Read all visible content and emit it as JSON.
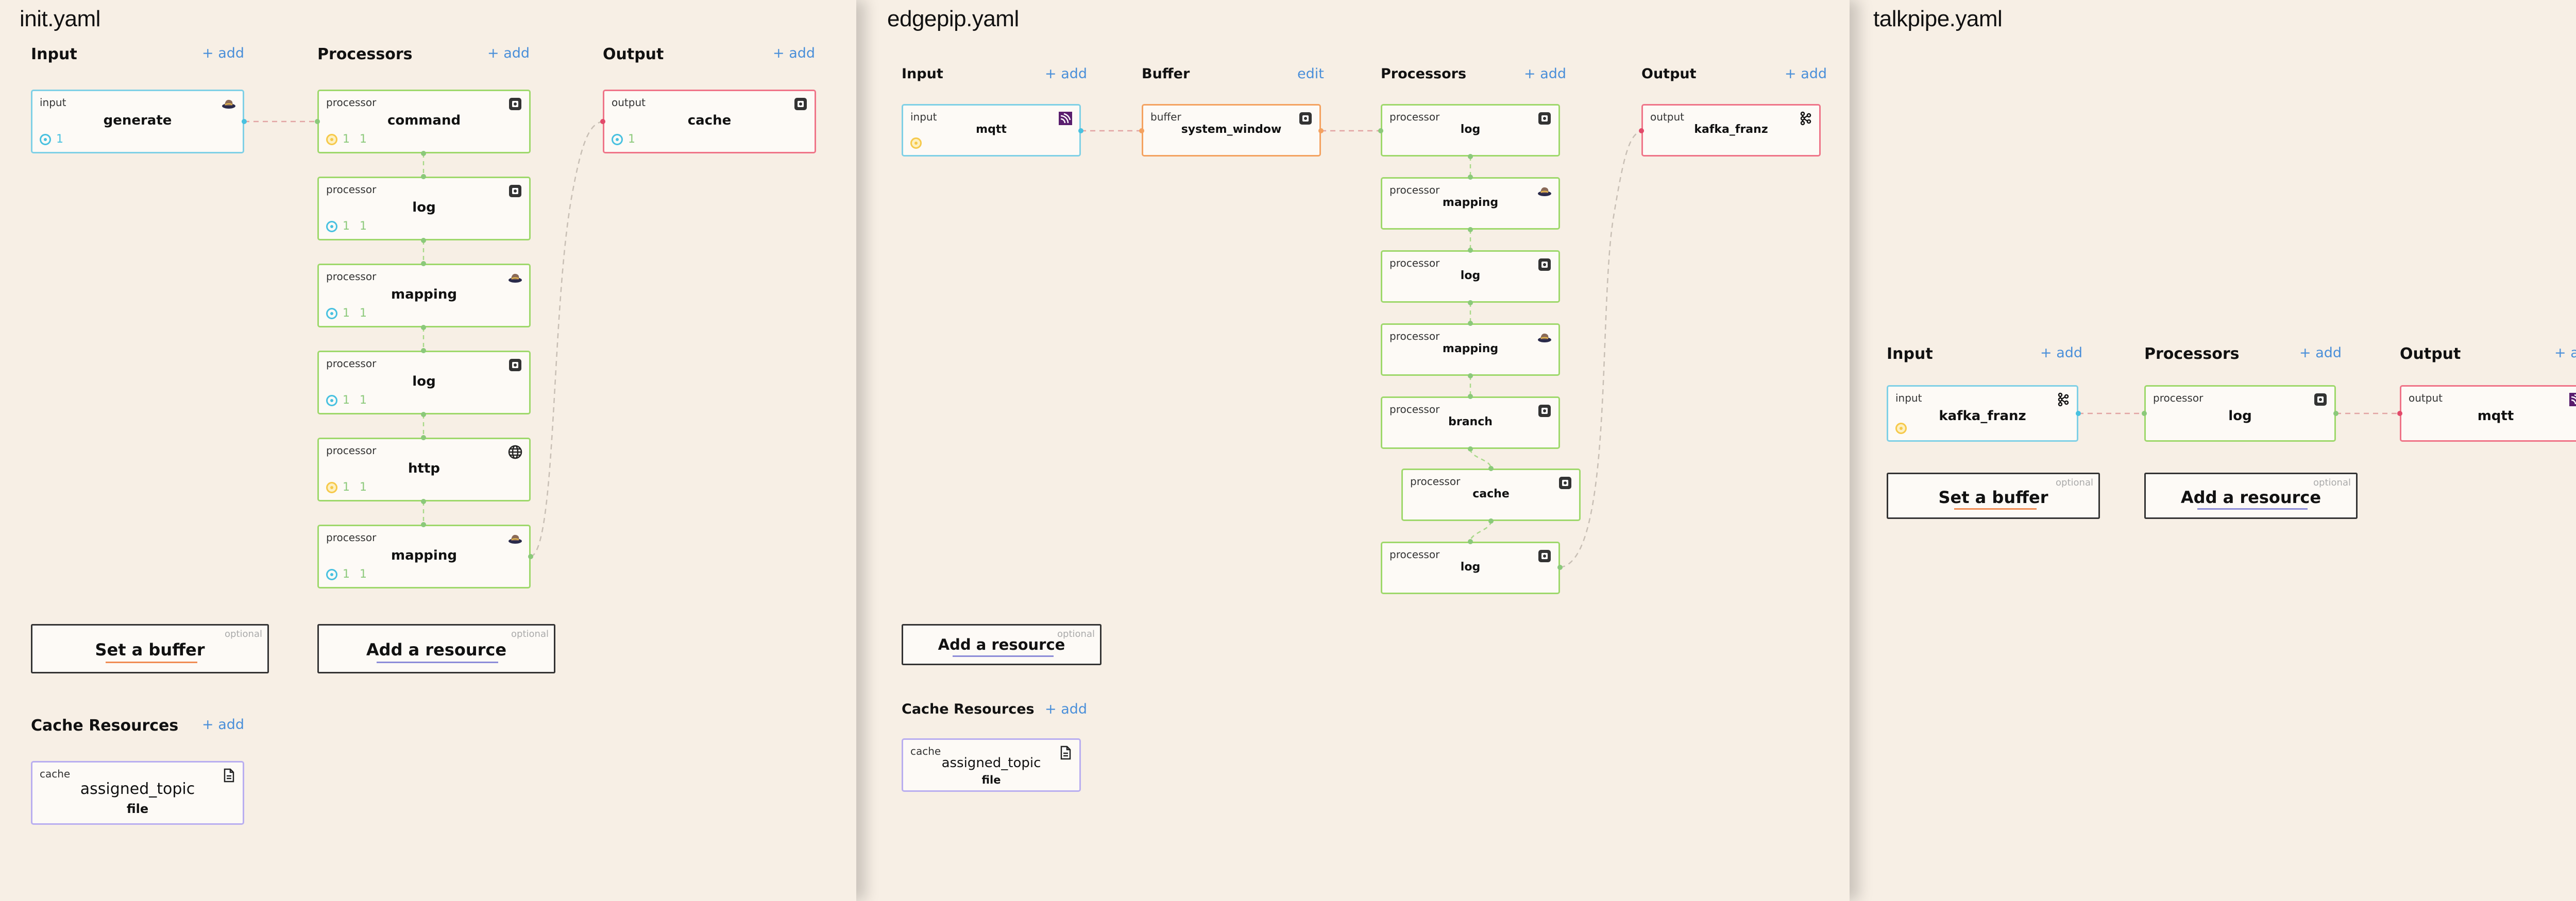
{
  "panels": {
    "init": {
      "title": "init.yaml",
      "input": {
        "heading": "Input",
        "add": "+ add",
        "kind": "input",
        "name": "generate",
        "icon": "bloblang-hat-icon",
        "stat": "1"
      },
      "processors": {
        "heading": "Processors",
        "add": "+ add",
        "items": [
          {
            "kind": "processor",
            "name": "command",
            "icon": "box-icon",
            "stat": "1 1"
          },
          {
            "kind": "processor",
            "name": "log",
            "icon": "box-icon",
            "stat": "1 1"
          },
          {
            "kind": "processor",
            "name": "mapping",
            "icon": "bloblang-hat-icon",
            "stat": "1 1"
          },
          {
            "kind": "processor",
            "name": "log",
            "icon": "box-icon",
            "stat": "1 1"
          },
          {
            "kind": "processor",
            "name": "http",
            "icon": "globe-icon",
            "stat": "1 1"
          },
          {
            "kind": "processor",
            "name": "mapping",
            "icon": "bloblang-hat-icon",
            "stat": "1 1"
          }
        ]
      },
      "output": {
        "heading": "Output",
        "add": "+ add",
        "kind": "output",
        "name": "cache",
        "icon": "box-icon",
        "stat": "1"
      },
      "buffer_btn": {
        "label": "Set a buffer",
        "optional": "optional"
      },
      "resource_btn": {
        "label": "Add a resource",
        "optional": "optional"
      },
      "cache_resources": {
        "heading": "Cache Resources",
        "add": "+ add",
        "kind": "cache",
        "name": "assigned_topic",
        "sub": "file",
        "icon": "file-icon"
      }
    },
    "edge": {
      "title": "edgepip.yaml",
      "input": {
        "heading": "Input",
        "add": "+ add",
        "kind": "input",
        "name": "mqtt",
        "icon": "mqtt-icon"
      },
      "buffer": {
        "heading": "Buffer",
        "add": "edit",
        "kind": "buffer",
        "name": "system_window",
        "icon": "box-icon"
      },
      "processors": {
        "heading": "Processors",
        "add": "+ add",
        "items": [
          {
            "kind": "processor",
            "name": "log",
            "icon": "box-icon"
          },
          {
            "kind": "processor",
            "name": "mapping",
            "icon": "bloblang-hat-icon"
          },
          {
            "kind": "processor",
            "name": "log",
            "icon": "box-icon"
          },
          {
            "kind": "processor",
            "name": "mapping",
            "icon": "bloblang-hat-icon"
          },
          {
            "kind": "processor",
            "name": "branch",
            "icon": "box-icon"
          },
          {
            "kind": "processor",
            "name": "cache",
            "icon": "box-icon"
          },
          {
            "kind": "processor",
            "name": "log",
            "icon": "box-icon"
          }
        ]
      },
      "output": {
        "heading": "Output",
        "add": "+ add",
        "kind": "output",
        "name": "kafka_franz",
        "icon": "kafka-icon"
      },
      "resource_btn": {
        "label": "Add a resource",
        "optional": "optional"
      },
      "cache_resources": {
        "heading": "Cache Resources",
        "add": "+ add",
        "kind": "cache",
        "name": "assigned_topic",
        "sub": "file",
        "icon": "file-icon"
      }
    },
    "talk": {
      "title": "talkpipe.yaml",
      "input": {
        "heading": "Input",
        "add": "+ add",
        "kind": "input",
        "name": "kafka_franz",
        "icon": "kafka-icon"
      },
      "processors": {
        "heading": "Processors",
        "add": "+ add",
        "items": [
          {
            "kind": "processor",
            "name": "log",
            "icon": "box-icon"
          }
        ]
      },
      "output": {
        "heading": "Output",
        "add": "+ add",
        "kind": "output",
        "name": "mqtt",
        "icon": "mqtt-icon"
      },
      "buffer_btn": {
        "label": "Set a buffer",
        "optional": "optional"
      },
      "resource_btn": {
        "label": "Add a resource",
        "optional": "optional"
      }
    }
  },
  "colors": {
    "background": "#f7efe5",
    "input_border": "#7fd0e6",
    "processor_border": "#9ed86b",
    "output_border": "#ef7488",
    "buffer_border": "#f4a260",
    "cache_border": "#b9aef0",
    "link": "#4a8fd9"
  }
}
